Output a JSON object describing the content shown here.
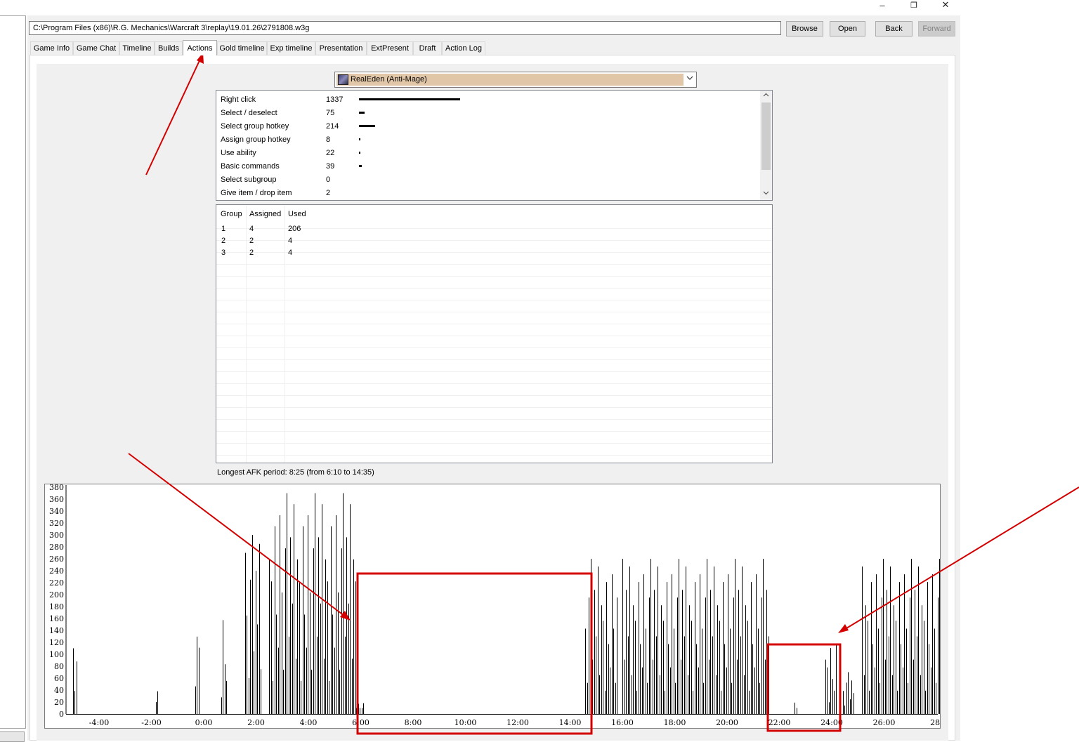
{
  "window": {
    "minimize_glyph": "–",
    "restore_glyph": "❐",
    "close_glyph": "✕"
  },
  "toolbar": {
    "path_value": "C:\\Program Files (x86)\\R.G. Mechanics\\Warcraft 3\\replay\\19.01.26\\2791808.w3g",
    "browse_label": "Browse",
    "open_label": "Open",
    "back_label": "Back",
    "forward_label": "Forward"
  },
  "tabs": [
    {
      "label": "Game Info"
    },
    {
      "label": "Game Chat"
    },
    {
      "label": "Timeline"
    },
    {
      "label": "Builds"
    },
    {
      "label": "Actions",
      "active": true
    },
    {
      "label": "Gold timeline"
    },
    {
      "label": "Exp timeline"
    },
    {
      "label": "Presentation"
    },
    {
      "label": "ExtPresent"
    },
    {
      "label": "Draft"
    },
    {
      "label": "Action Log"
    }
  ],
  "player_select": {
    "value": "RealEden (Anti-Mage)",
    "highlight_color": "#e2c6a8"
  },
  "actions": [
    {
      "name": "Right click",
      "count": 1337
    },
    {
      "name": "Select / deselect",
      "count": 75
    },
    {
      "name": "Select group hotkey",
      "count": 214
    },
    {
      "name": "Assign group hotkey",
      "count": 8
    },
    {
      "name": "Use ability",
      "count": 22
    },
    {
      "name": "Basic commands",
      "count": 39
    },
    {
      "name": "Select subgroup",
      "count": 0
    },
    {
      "name": "Give item / drop item",
      "count": 2
    }
  ],
  "groups": {
    "headers": [
      "Group",
      "Assigned",
      "Used"
    ],
    "rows": [
      [
        "1",
        "4",
        "206"
      ],
      [
        "2",
        "2",
        "4"
      ],
      [
        "3",
        "2",
        "4"
      ]
    ]
  },
  "afk_text": "Longest AFK period: 8:25 (from 6:10 to 14:35)",
  "chart_data": {
    "type": "bar",
    "y_ticks": [
      "380",
      "360",
      "340",
      "320",
      "300",
      "280",
      "260",
      "240",
      "220",
      "200",
      "180",
      "160",
      "140",
      "120",
      "100",
      "80",
      "60",
      "40",
      "20",
      "0"
    ],
    "x_ticks": [
      "-4:00",
      "-2:00",
      "0:00",
      "2:00",
      "4:00",
      "6:00",
      "8:00",
      "10:00",
      "12:00",
      "14:00",
      "16:00",
      "18:00",
      "20:00",
      "22:00",
      "24:00",
      "26:00",
      "28:"
    ],
    "ylim": [
      0,
      380
    ],
    "xlim_minutes": [
      -5.25,
      28.9
    ],
    "bar_color": "#000000",
    "activity_ranges": [
      {
        "from": "-5:00",
        "to": "-4:50",
        "peak": 110
      },
      {
        "from": "-1:50",
        "to": "-1:45",
        "peak": 40
      },
      {
        "from": "-0:20",
        "to": "-0:10",
        "peak": 185
      },
      {
        "from": "0:40",
        "to": "0:55",
        "peak": 185
      },
      {
        "from": "1:35",
        "to": "2:15",
        "peak": 300
      },
      {
        "from": "2:30",
        "to": "5:50",
        "peak": 370
      },
      {
        "from": "5:50",
        "to": "6:10",
        "peak": 20
      },
      {
        "from": "14:35",
        "to": "15:50",
        "peak": 260
      },
      {
        "from": "16:00",
        "to": "21:35",
        "peak": 260
      },
      {
        "from": "22:35",
        "to": "22:40",
        "peak": 20
      },
      {
        "from": "23:45",
        "to": "24:10",
        "peak": 130
      },
      {
        "from": "24:25",
        "to": "24:50",
        "peak": 70
      },
      {
        "from": "25:10",
        "to": "28:30",
        "peak": 260
      },
      {
        "from": "28:40",
        "to": "28:50",
        "peak": 40
      }
    ]
  }
}
